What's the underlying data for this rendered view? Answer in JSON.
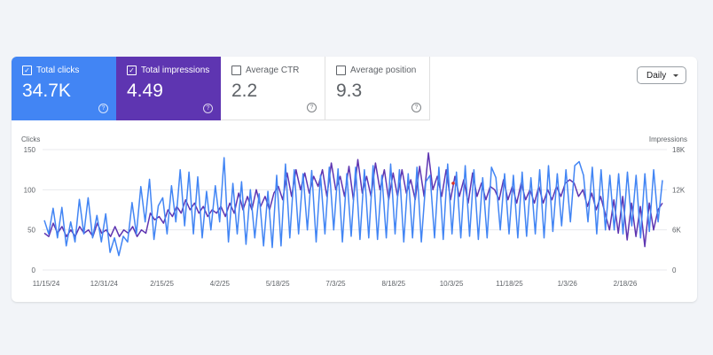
{
  "metrics": [
    {
      "label": "Total clicks",
      "value": "34.7K",
      "checked": true,
      "color": "#4285f4"
    },
    {
      "label": "Total impressions",
      "value": "4.49",
      "checked": true,
      "color": "#5e35b1"
    },
    {
      "label": "Average CTR",
      "value": "2.2",
      "checked": false
    },
    {
      "label": "Average position",
      "value": "9.3",
      "checked": false
    }
  ],
  "help_icon": "question-circle-icon",
  "granularity": {
    "selected": "Daily"
  },
  "chart_data": {
    "type": "line",
    "left_axis": {
      "label": "Clicks",
      "ticks": [
        "0",
        "50",
        "100",
        "150"
      ],
      "range": [
        0,
        150
      ]
    },
    "right_axis": {
      "label": "Impressions",
      "ticks": [
        "0",
        "6K",
        "12K",
        "18K"
      ],
      "range": [
        0,
        18000
      ]
    },
    "x_tick_labels": [
      "11/15/24",
      "12/31/24",
      "2/15/25",
      "4/2/25",
      "5/18/25",
      "7/3/25",
      "8/18/25",
      "10/3/25",
      "11/18/25",
      "1/3/26",
      "2/18/26"
    ],
    "grid": true,
    "series": [
      {
        "name": "Clicks",
        "axis": "left",
        "color": "#4285f4",
        "values": [
          62,
          45,
          77,
          40,
          78,
          30,
          60,
          35,
          88,
          45,
          90,
          40,
          68,
          35,
          70,
          22,
          40,
          18,
          42,
          35,
          84,
          45,
          104,
          60,
          113,
          38,
          80,
          90,
          45,
          105,
          60,
          125,
          55,
          122,
          45,
          116,
          40,
          98,
          50,
          105,
          60,
          140,
          35,
          108,
          45,
          110,
          32,
          100,
          40,
          95,
          30,
          98,
          28,
          118,
          30,
          132,
          40,
          125,
          45,
          120,
          50,
          124,
          35,
          118,
          45,
          128,
          50,
          126,
          35,
          120,
          42,
          128,
          38,
          125,
          40,
          130,
          38,
          118,
          40,
          132,
          45,
          125,
          35,
          120,
          40,
          128,
          35,
          110,
          118,
          40,
          128,
          38,
          132,
          45,
          122,
          40,
          130,
          42,
          125,
          38,
          115,
          40,
          128,
          115,
          50,
          120,
          45,
          118,
          40,
          122,
          42,
          115,
          45,
          125,
          40,
          130,
          48,
          120,
          55,
          125,
          60,
          130,
          135,
          118,
          60,
          128,
          45,
          125,
          50,
          118,
          50,
          120,
          45,
          122,
          55,
          118,
          40,
          120,
          48,
          125,
          60,
          112
        ]
      },
      {
        "name": "Impressions",
        "axis": "right",
        "color": "#5e35b1",
        "values": [
          5500,
          5000,
          7000,
          5500,
          6500,
          5000,
          6000,
          5000,
          6500,
          5500,
          6000,
          5000,
          7000,
          5500,
          6000,
          5000,
          6500,
          5000,
          6000,
          5500,
          6500,
          5000,
          6000,
          5500,
          8500,
          7500,
          8000,
          7000,
          9000,
          8000,
          9500,
          8500,
          10500,
          9000,
          10000,
          8500,
          9500,
          8000,
          9000,
          8500,
          9500,
          8000,
          10000,
          8500,
          11500,
          9000,
          11000,
          9000,
          12000,
          9500,
          11000,
          9000,
          11500,
          12500,
          10500,
          14500,
          11000,
          15000,
          12000,
          14500,
          11500,
          14000,
          12500,
          15000,
          11000,
          16000,
          12000,
          14000,
          11000,
          15500,
          10500,
          16500,
          11500,
          14000,
          11000,
          16000,
          12000,
          15000,
          10500,
          14500,
          11000,
          15000,
          11500,
          13500,
          10500,
          15500,
          11000,
          17500,
          12000,
          14000,
          11000,
          15000,
          10500,
          14000,
          11000,
          13500,
          10000,
          14500,
          11000,
          13000,
          10500,
          12500,
          12000,
          10500,
          13500,
          10500,
          12500,
          10000,
          13000,
          10500,
          12000,
          10000,
          12500,
          10000,
          12000,
          10500,
          12500,
          11000,
          13000,
          13500,
          13000,
          11000,
          12000,
          9500,
          11500,
          9000,
          11000,
          8500,
          6000,
          10500,
          5500,
          11000,
          4500,
          10000,
          5000,
          9500,
          3500,
          10000,
          6000,
          9000,
          10000
        ]
      }
    ]
  }
}
